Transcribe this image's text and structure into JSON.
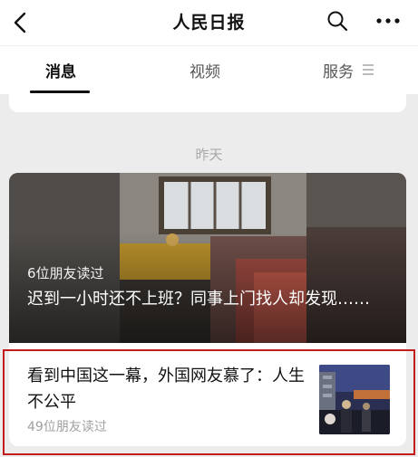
{
  "header": {
    "title": "人民日报"
  },
  "tabs": [
    {
      "label": "消息",
      "active": true
    },
    {
      "label": "视频",
      "active": false
    },
    {
      "label": "服务",
      "active": false
    }
  ],
  "feed": {
    "date_label": "昨天",
    "featured": {
      "readers": "6位朋友读过",
      "title": "迟到一小时还不上班？同事上门找人却发现……"
    },
    "item": {
      "title": "看到中国这一幕，外国网友慕了：人生不公平",
      "readers": "49位朋友读过"
    }
  },
  "icons": [
    "back-icon",
    "search-icon",
    "more-icon",
    "menu-icon"
  ],
  "colors": {
    "highlight_border": "#c21c1c",
    "feed_background": "#ececec"
  }
}
